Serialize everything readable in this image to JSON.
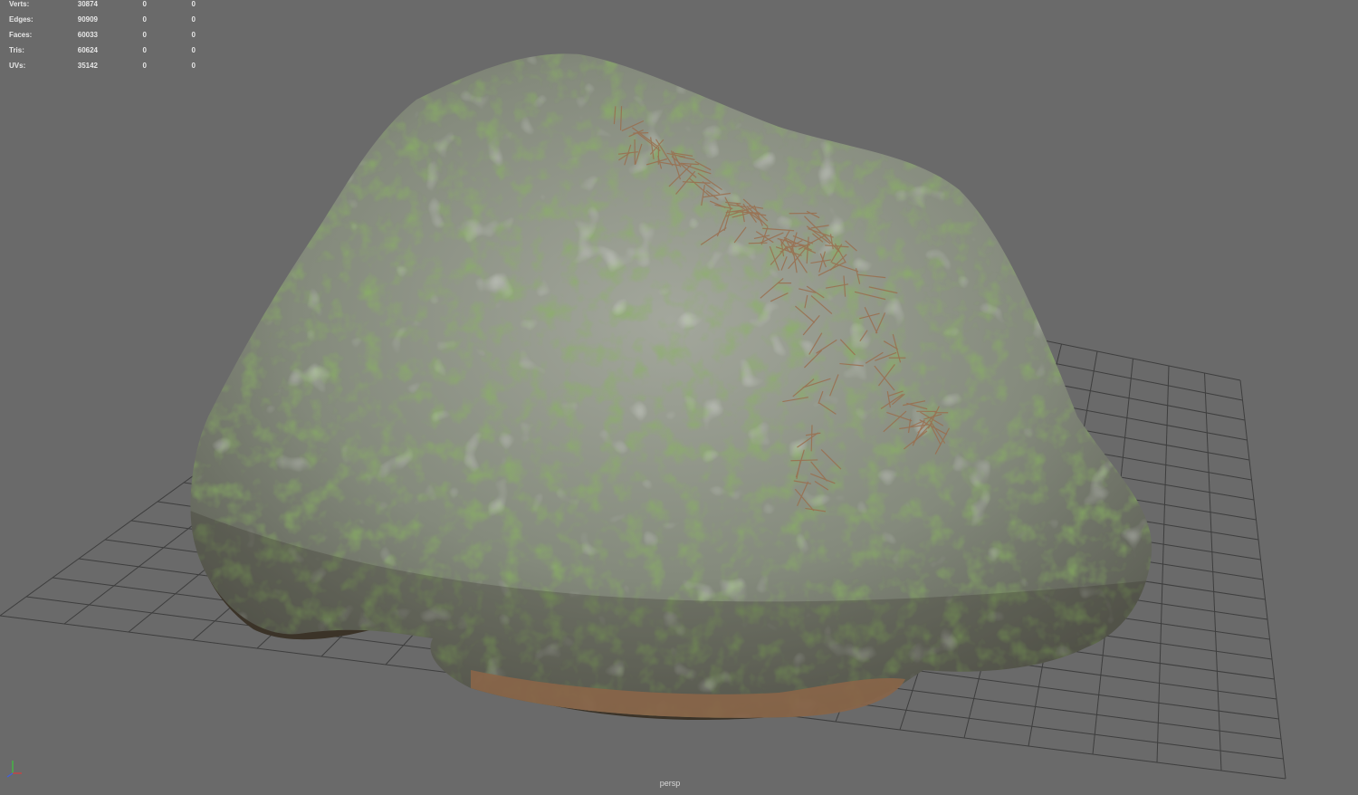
{
  "viewport": {
    "camera": "persp",
    "background_color": "#6a6a6a",
    "grid_color": "#3e3e3e"
  },
  "hud": {
    "rows": [
      {
        "label": "Verts:",
        "v1": "30874",
        "v2": "0",
        "v3": "0"
      },
      {
        "label": "Edges:",
        "v1": "90909",
        "v2": "0",
        "v3": "0"
      },
      {
        "label": "Faces:",
        "v1": "60033",
        "v2": "0",
        "v3": "0"
      },
      {
        "label": "Tris:",
        "v1": "60624",
        "v2": "0",
        "v3": "0"
      },
      {
        "label": "UVs:",
        "v1": "35142",
        "v2": "0",
        "v3": "0"
      }
    ]
  },
  "model": {
    "icon": "mossy-rock-model",
    "colors": {
      "stone": "#8e918a",
      "moss": "#5f8a2a",
      "moss_bright": "#7aa53a",
      "lichen": "#c2c8c4",
      "pine_needles": "#9a6e4e",
      "shadow": "#3b3328"
    }
  },
  "axis_gizmo": {
    "icon": "axis-gizmo-icon",
    "x_color": "#d04040",
    "y_color": "#40c040",
    "z_color": "#4060e0"
  }
}
